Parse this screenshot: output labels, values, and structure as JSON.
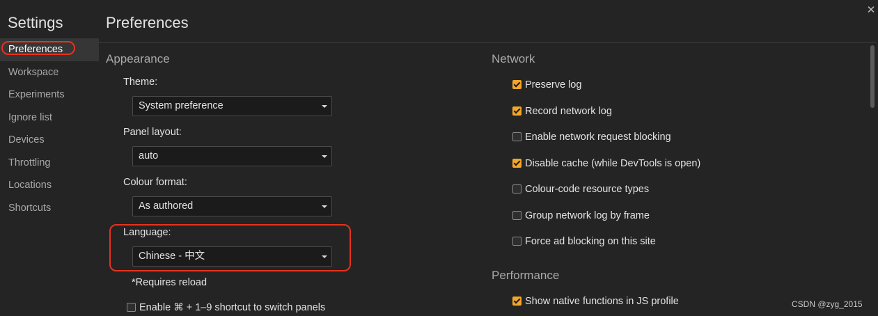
{
  "sidebar": {
    "title": "Settings",
    "items": [
      {
        "label": "Preferences",
        "selected": true
      },
      {
        "label": "Workspace"
      },
      {
        "label": "Experiments"
      },
      {
        "label": "Ignore list"
      },
      {
        "label": "Devices"
      },
      {
        "label": "Throttling"
      },
      {
        "label": "Locations"
      },
      {
        "label": "Shortcuts"
      }
    ]
  },
  "close_icon": "close-icon",
  "page": {
    "title": "Preferences"
  },
  "appearance": {
    "title": "Appearance",
    "theme": {
      "label": "Theme:",
      "value": "System preference"
    },
    "panel_layout": {
      "label": "Panel layout:",
      "value": "auto"
    },
    "colour_format": {
      "label": "Colour format:",
      "value": "As authored"
    },
    "language": {
      "label": "Language:",
      "value": "Chinese - 中文"
    },
    "requires_reload": "*Requires reload",
    "shortcut_option": {
      "label": "Enable ⌘ + 1–9 shortcut to switch panels",
      "checked": false
    }
  },
  "network": {
    "title": "Network",
    "options": [
      {
        "label": "Preserve log",
        "checked": true
      },
      {
        "label": "Record network log",
        "checked": true
      },
      {
        "label": "Enable network request blocking",
        "checked": false
      },
      {
        "label": "Disable cache (while DevTools is open)",
        "checked": true
      },
      {
        "label": "Colour-code resource types",
        "checked": false
      },
      {
        "label": "Group network log by frame",
        "checked": false
      },
      {
        "label": "Force ad blocking on this site",
        "checked": false
      }
    ]
  },
  "performance": {
    "title": "Performance",
    "options": [
      {
        "label": "Show native functions in JS profile",
        "checked": true
      }
    ]
  },
  "watermark": "CSDN @zyg_2015",
  "colors": {
    "checkbox_checked": "#f4a62a",
    "highlight_annotation": "#e8321c",
    "background": "#242424"
  }
}
